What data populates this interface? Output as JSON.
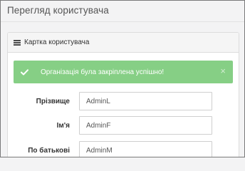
{
  "page": {
    "title": "Перегляд користувача"
  },
  "panel": {
    "heading": "Картка користувача",
    "icon": "list-icon"
  },
  "alert": {
    "message": "Організація була закріплена успішно!",
    "close_symbol": "×",
    "color": "#86cf85"
  },
  "form": {
    "fields": [
      {
        "label": "Прізвище",
        "value": "AdminL"
      },
      {
        "label": "Ім'я",
        "value": "AdminF"
      },
      {
        "label": "По батькові",
        "value": "AdminM"
      }
    ]
  }
}
